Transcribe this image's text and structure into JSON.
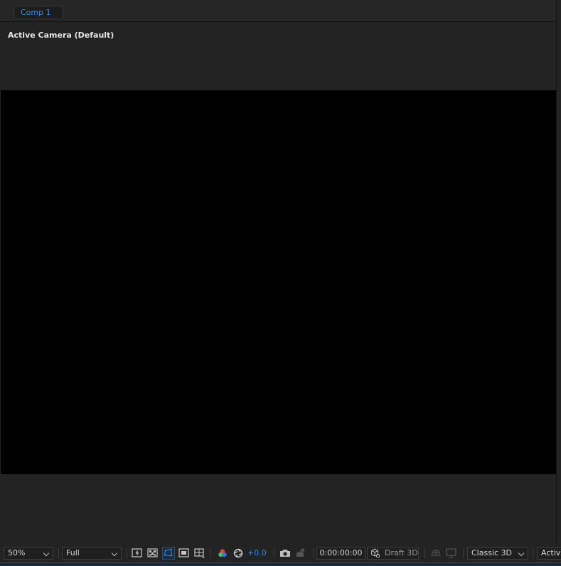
{
  "tabs": [
    {
      "label": "Comp 1"
    }
  ],
  "viewer": {
    "camera_label": "Active Camera (Default)"
  },
  "toolbar": {
    "zoom": "50%",
    "resolution": "Full",
    "exposure": "+0.0",
    "timecode": "0:00:00:00",
    "draft3d": "Draft 3D",
    "renderer": "Classic 3D",
    "view_partial": "Activ"
  },
  "colors": {
    "accent": "#2d8ceb",
    "viewer_bg": "#000000",
    "panel_bg": "#232323"
  }
}
